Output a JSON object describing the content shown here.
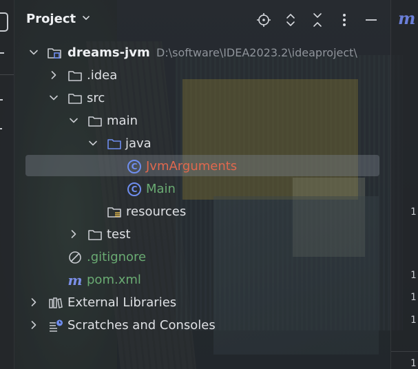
{
  "header": {
    "title": "Project",
    "icons": [
      "chevron-down-icon",
      "locate-icon",
      "expand-all-icon",
      "collapse-all-icon",
      "more-options-icon",
      "minimize-icon"
    ]
  },
  "tree": {
    "root": {
      "label": "dreams-jvm",
      "path": "D:\\software\\IDEA2023.2\\ideaproject\\"
    },
    "idea": {
      "label": ".idea"
    },
    "src": {
      "label": "src"
    },
    "main": {
      "label": "main"
    },
    "java": {
      "label": "java"
    },
    "jvm_arguments": {
      "label": "JvmArguments"
    },
    "main_class": {
      "label": "Main"
    },
    "resources": {
      "label": "resources"
    },
    "test": {
      "label": "test"
    },
    "gitignore": {
      "label": ".gitignore"
    },
    "pom": {
      "label": "pom.xml"
    },
    "external_libraries": {
      "label": "External Libraries"
    },
    "scratches": {
      "label": "Scratches and Consoles"
    }
  },
  "colors": {
    "accent": "#6f8ef0",
    "selected_file": "#e0684e",
    "vcs_added": "#6aab73",
    "path_gray": "#8f949b"
  }
}
